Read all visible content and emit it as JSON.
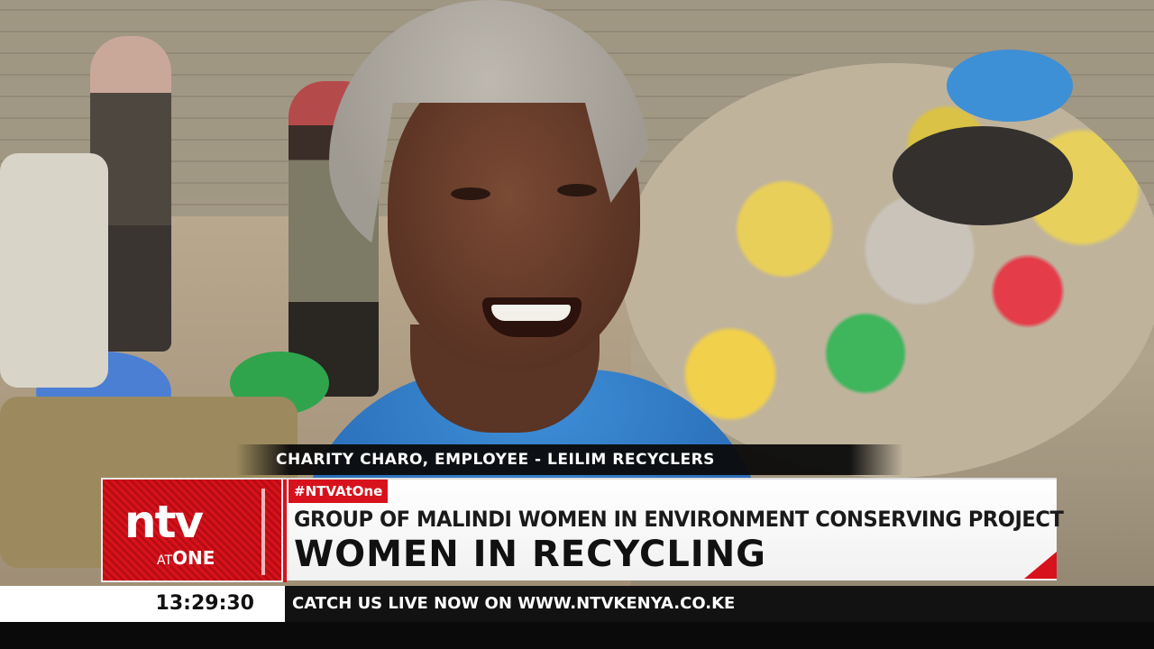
{
  "strap": {
    "name_title": "CHARITY CHARO, EMPLOYEE - LEILIM RECYCLERS"
  },
  "logo": {
    "main": "ntv",
    "sub_at": "AT",
    "sub_one": "ONE"
  },
  "headline": {
    "hashtag": "#NTVAtOne",
    "subtitle": "GROUP OF MALINDI WOMEN IN ENVIRONMENT CONSERVING PROJECT",
    "title": "WOMEN IN RECYCLING"
  },
  "ticker": {
    "clock": "13:29:30",
    "text": "CATCH US LIVE NOW ON WWW.NTVKENYA.CO.KE"
  },
  "colors": {
    "brand_red": "#d8121c",
    "ticker_bg": "#121212",
    "panel_bg": "#ffffff"
  }
}
